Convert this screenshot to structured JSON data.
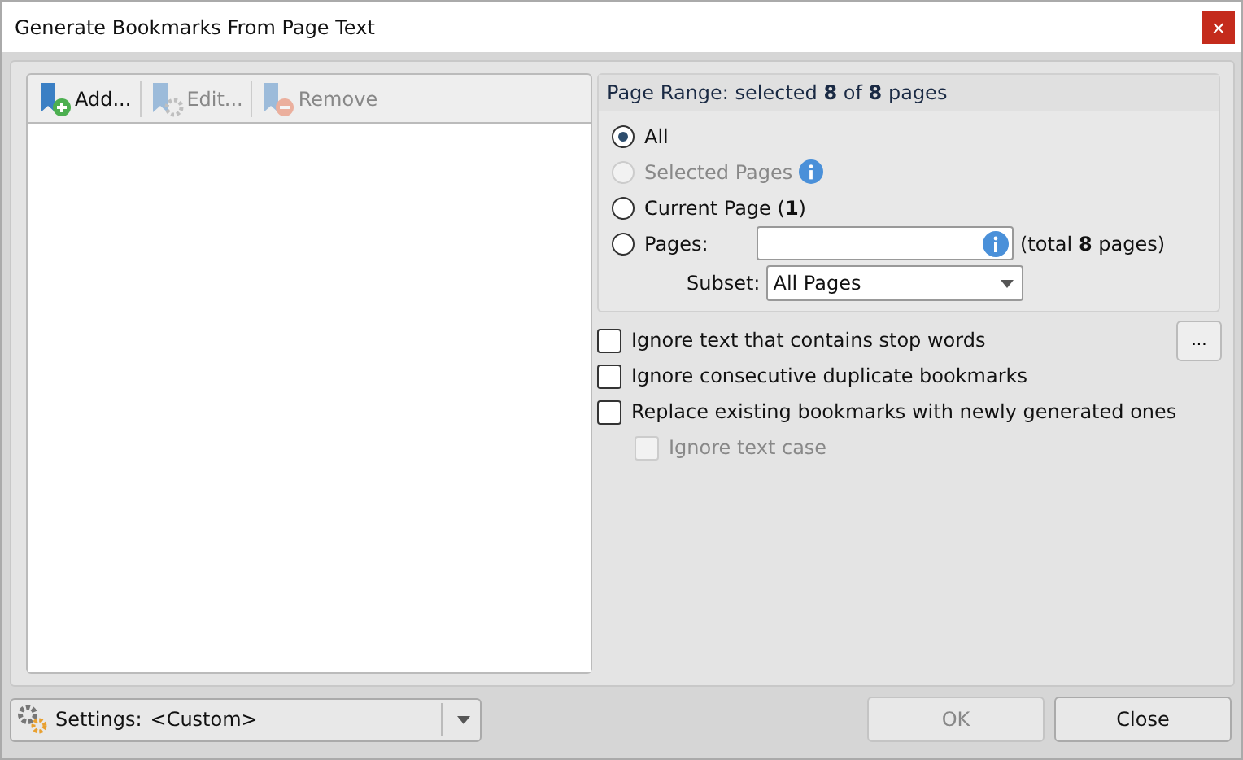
{
  "window": {
    "title": "Generate Bookmarks From Page Text",
    "close": "×"
  },
  "toolbar": [
    {
      "kind": "add",
      "label": "Add...",
      "disabled": false
    },
    {
      "kind": "edit",
      "label": "Edit...",
      "disabled": true
    },
    {
      "kind": "remove",
      "label": "Remove",
      "disabled": true
    }
  ],
  "page_range": {
    "header": "Page Range: selected **8** of **8** pages",
    "options": [
      {
        "kind": "plain",
        "label": "All",
        "selected": true,
        "disabled": false
      },
      {
        "kind": "info",
        "label": "Selected Pages",
        "selected": false,
        "disabled": true
      },
      {
        "kind": "plain",
        "label": "Current Page (**1**)",
        "selected": false,
        "disabled": false
      },
      {
        "kind": "field",
        "label": "Pages:",
        "selected": false,
        "disabled": false,
        "note": "(total **8** pages)"
      }
    ],
    "subset_label": "Subset:",
    "subset_value": "All Pages"
  },
  "options": [
    {
      "label": "Ignore text that contains stop words",
      "checked": false,
      "disabled": false,
      "more": "..."
    },
    {
      "label": "Ignore consecutive duplicate bookmarks",
      "checked": false,
      "disabled": false
    },
    {
      "label": "Replace existing bookmarks with newly generated ones",
      "checked": false,
      "disabled": false,
      "children": [
        {
          "label": "Ignore text case",
          "checked": false,
          "disabled": true
        }
      ]
    }
  ],
  "settings": {
    "label": "Settings:",
    "value": "<Custom>"
  },
  "buttons": [
    {
      "label": "OK",
      "disabled": true
    },
    {
      "label": "Close",
      "disabled": false
    }
  ]
}
